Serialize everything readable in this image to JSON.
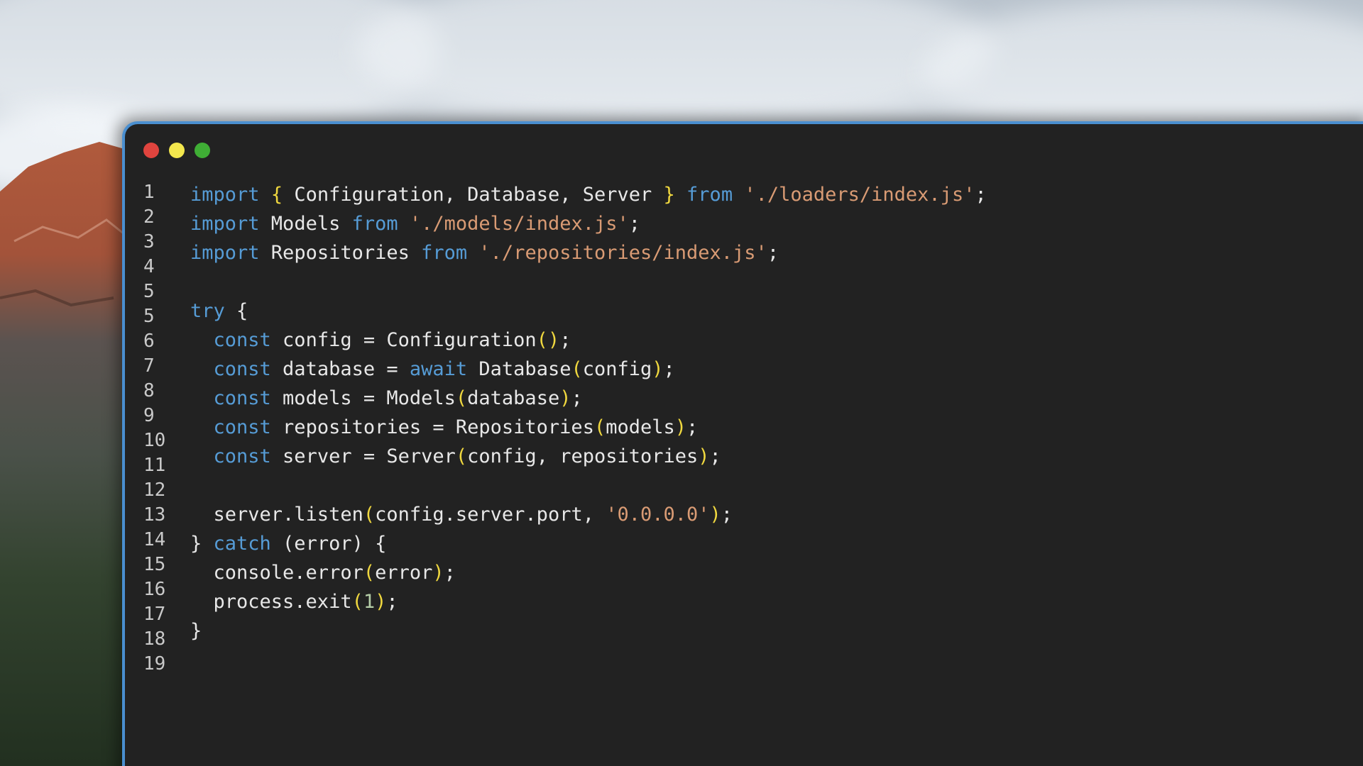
{
  "window": {
    "traffic_lights": [
      {
        "name": "close",
        "color": "#e0443e"
      },
      {
        "name": "minimize",
        "color": "#f3e74d"
      },
      {
        "name": "zoom",
        "color": "#3fae35"
      }
    ]
  },
  "colors": {
    "keyword": "#569cd6",
    "identifier": "#e8e8e8",
    "bracket": "#f0d83f",
    "string": "#d99b74",
    "number": "#b5cea8",
    "editor_background": "#222222",
    "window_border": "#4a8fd0"
  },
  "gutter": {
    "line_numbers": [
      "1",
      "2",
      "3",
      "4",
      "5",
      "5",
      "6",
      "7",
      "8",
      "9",
      "10",
      "11",
      "12",
      "13",
      "14",
      "15",
      "16",
      "17",
      "18",
      "19"
    ]
  },
  "code": {
    "lines": [
      [
        [
          "keyword",
          "import"
        ],
        [
          "ident",
          " "
        ],
        [
          "bracket",
          "{"
        ],
        [
          "ident",
          " Configuration, Database, Server "
        ],
        [
          "bracket",
          "}"
        ],
        [
          "ident",
          " "
        ],
        [
          "keyword",
          "from"
        ],
        [
          "ident",
          " "
        ],
        [
          "string",
          "'./loaders/index.js'"
        ],
        [
          "punct",
          ";"
        ]
      ],
      [
        [
          "keyword",
          "import"
        ],
        [
          "ident",
          " Models "
        ],
        [
          "keyword",
          "from"
        ],
        [
          "ident",
          " "
        ],
        [
          "string",
          "'./models/index.js'"
        ],
        [
          "punct",
          ";"
        ]
      ],
      [
        [
          "keyword",
          "import"
        ],
        [
          "ident",
          " Repositories "
        ],
        [
          "keyword",
          "from"
        ],
        [
          "ident",
          " "
        ],
        [
          "string",
          "'./repositories/index.js'"
        ],
        [
          "punct",
          ";"
        ]
      ],
      [],
      [
        [
          "keyword",
          "try"
        ],
        [
          "ident",
          " {"
        ]
      ],
      [
        [
          "ident",
          "  "
        ],
        [
          "keyword",
          "const"
        ],
        [
          "ident",
          " config = Configuration"
        ],
        [
          "bracket",
          "()"
        ],
        [
          "punct",
          ";"
        ]
      ],
      [
        [
          "ident",
          "  "
        ],
        [
          "keyword",
          "const"
        ],
        [
          "ident",
          " database = "
        ],
        [
          "keyword",
          "await"
        ],
        [
          "ident",
          " Database"
        ],
        [
          "bracket",
          "("
        ],
        [
          "ident",
          "config"
        ],
        [
          "bracket",
          ")"
        ],
        [
          "punct",
          ";"
        ]
      ],
      [
        [
          "ident",
          "  "
        ],
        [
          "keyword",
          "const"
        ],
        [
          "ident",
          " models = Models"
        ],
        [
          "bracket",
          "("
        ],
        [
          "ident",
          "database"
        ],
        [
          "bracket",
          ")"
        ],
        [
          "punct",
          ";"
        ]
      ],
      [
        [
          "ident",
          "  "
        ],
        [
          "keyword",
          "const"
        ],
        [
          "ident",
          " repositories = Repositories"
        ],
        [
          "bracket",
          "("
        ],
        [
          "ident",
          "models"
        ],
        [
          "bracket",
          ")"
        ],
        [
          "punct",
          ";"
        ]
      ],
      [
        [
          "ident",
          "  "
        ],
        [
          "keyword",
          "const"
        ],
        [
          "ident",
          " server = Server"
        ],
        [
          "bracket",
          "("
        ],
        [
          "ident",
          "config, repositories"
        ],
        [
          "bracket",
          ")"
        ],
        [
          "punct",
          ";"
        ]
      ],
      [],
      [
        [
          "ident",
          "  server.listen"
        ],
        [
          "bracket",
          "("
        ],
        [
          "ident",
          "config.server.port, "
        ],
        [
          "string",
          "'0.0.0.0'"
        ],
        [
          "bracket",
          ")"
        ],
        [
          "punct",
          ";"
        ]
      ],
      [
        [
          "ident",
          "} "
        ],
        [
          "keyword",
          "catch"
        ],
        [
          "ident",
          " (error) {"
        ]
      ],
      [
        [
          "ident",
          "  console.error"
        ],
        [
          "bracket",
          "("
        ],
        [
          "ident",
          "error"
        ],
        [
          "bracket",
          ")"
        ],
        [
          "punct",
          ";"
        ]
      ],
      [
        [
          "ident",
          "  process.exit"
        ],
        [
          "bracket",
          "("
        ],
        [
          "number",
          "1"
        ],
        [
          "bracket",
          ")"
        ],
        [
          "punct",
          ";"
        ]
      ],
      [
        [
          "ident",
          "}"
        ]
      ]
    ]
  }
}
